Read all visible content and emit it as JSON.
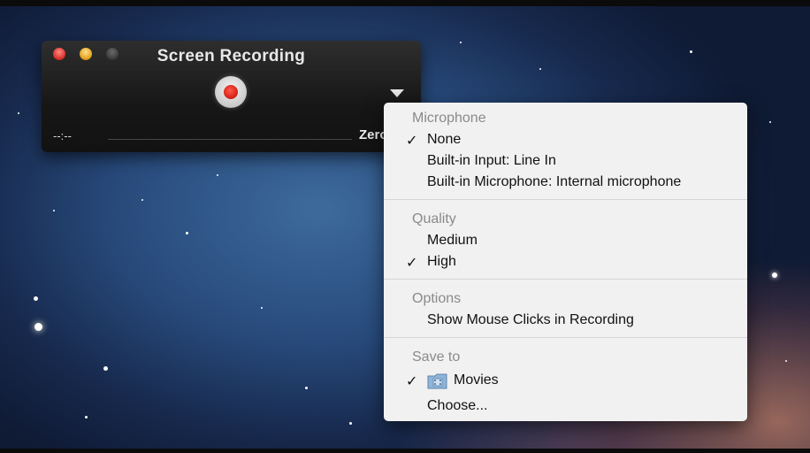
{
  "window": {
    "title": "Screen Recording",
    "time": "--:--",
    "size": "Zero KB"
  },
  "menu": {
    "microphone": {
      "header": "Microphone",
      "items": [
        {
          "label": "None",
          "checked": true
        },
        {
          "label": "Built-in Input: Line In",
          "checked": false
        },
        {
          "label": "Built-in Microphone: Internal microphone",
          "checked": false
        }
      ]
    },
    "quality": {
      "header": "Quality",
      "items": [
        {
          "label": "Medium",
          "checked": false
        },
        {
          "label": "High",
          "checked": true
        }
      ]
    },
    "options": {
      "header": "Options",
      "items": [
        {
          "label": "Show Mouse Clicks in Recording",
          "checked": false
        }
      ]
    },
    "save_to": {
      "header": "Save to",
      "items": [
        {
          "label": "Movies",
          "checked": true,
          "icon": "movies-folder-icon"
        },
        {
          "label": "Choose...",
          "checked": false
        }
      ]
    },
    "check_mark": "✓"
  },
  "colors": {
    "record": "#d11e12",
    "menu_bg": "#f1f1f1",
    "header_text": "#8a8a8a"
  }
}
